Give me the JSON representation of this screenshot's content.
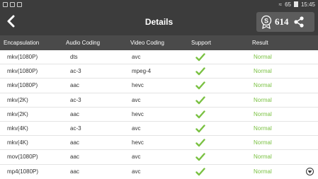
{
  "status_bar": {
    "signal": "65",
    "time": "15:45"
  },
  "header": {
    "title": "Details",
    "score": "614"
  },
  "table": {
    "columns": [
      "Encapsulation",
      "Audio Coding",
      "Video Coding",
      "Support",
      "Result"
    ],
    "rows": [
      {
        "enc": "mkv(1080P)",
        "audio": "dts",
        "video": "avc",
        "support": "check",
        "result": "Normal"
      },
      {
        "enc": "mkv(1080P)",
        "audio": "ac-3",
        "video": "mpeg-4",
        "support": "check",
        "result": "Normal"
      },
      {
        "enc": "mkv(1080P)",
        "audio": "aac",
        "video": "hevc",
        "support": "check",
        "result": "Normal"
      },
      {
        "enc": "mkv(2K)",
        "audio": "ac-3",
        "video": "avc",
        "support": "check",
        "result": "Normal"
      },
      {
        "enc": "mkv(2K)",
        "audio": "aac",
        "video": "hevc",
        "support": "check",
        "result": "Normal"
      },
      {
        "enc": "mkv(4K)",
        "audio": "ac-3",
        "video": "avc",
        "support": "check",
        "result": "Normal"
      },
      {
        "enc": "mkv(4K)",
        "audio": "aac",
        "video": "hevc",
        "support": "check",
        "result": "Normal"
      },
      {
        "enc": "mov(1080P)",
        "audio": "aac",
        "video": "avc",
        "support": "check",
        "result": "Normal"
      },
      {
        "enc": "mp4(1080P)",
        "audio": "aac",
        "video": "avc",
        "support": "check",
        "result": "Normal"
      }
    ]
  },
  "icons": {
    "back": "back-arrow-icon",
    "badge": "award-badge-icon",
    "share": "share-icon",
    "check": "checkmark-icon",
    "scroll": "chevron-down-circle-icon"
  },
  "colors": {
    "appbar": "#3c3c3c",
    "table_header": "#4a4a4a",
    "check": "#7ac142",
    "result_text": "#7ac142"
  }
}
